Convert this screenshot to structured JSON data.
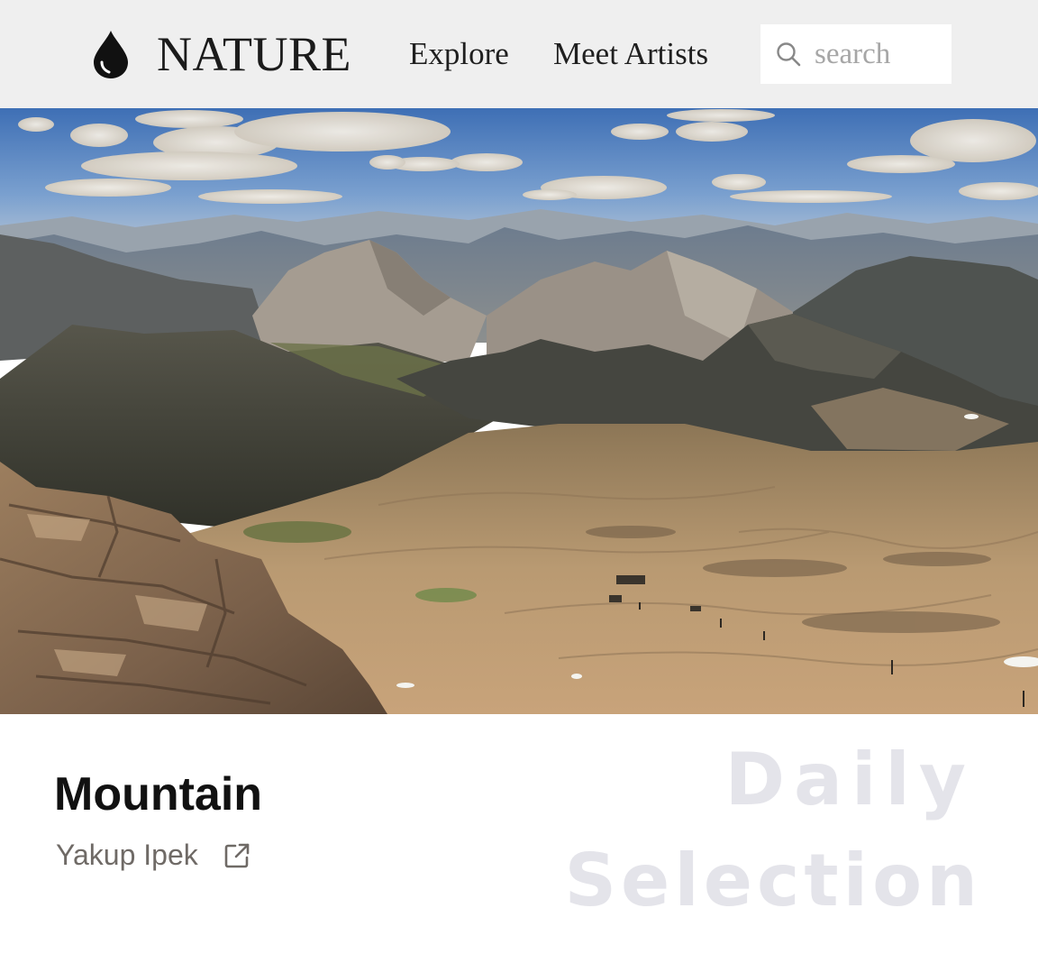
{
  "header": {
    "logo_icon": "water-drop-icon",
    "brand": "NATURE",
    "nav": [
      {
        "label": "Explore"
      },
      {
        "label": "Meet Artists"
      }
    ],
    "search": {
      "placeholder": "search",
      "value": "",
      "icon": "search-icon"
    }
  },
  "hero": {
    "subject": "mountain-landscape-photo"
  },
  "feature": {
    "title": "Mountain",
    "author": "Yakup Ipek",
    "author_link_icon": "external-link-icon",
    "watermark_line1": "Daily",
    "watermark_line2": "Selection"
  },
  "colors": {
    "header_bg": "#efefef",
    "watermark": "#e4e4ea",
    "author_text": "#6f6a66"
  }
}
